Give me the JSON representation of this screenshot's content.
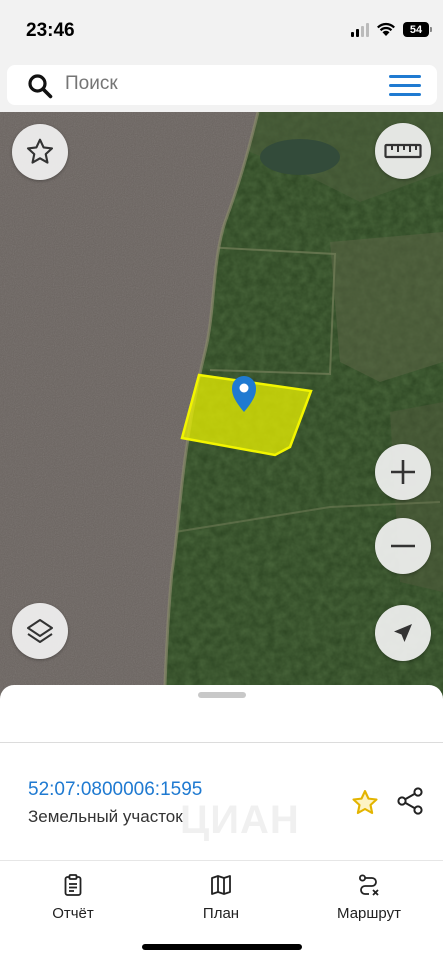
{
  "status_bar": {
    "time": "23:46",
    "battery": "54",
    "icons": [
      "signal-icon",
      "wifi-icon",
      "battery-icon"
    ]
  },
  "search": {
    "placeholder": "Поиск",
    "icon": "search-icon",
    "menu_icon": "hamburger-menu-icon"
  },
  "map": {
    "buttons": [
      "star-icon",
      "ruler-icon",
      "layers-icon",
      "zoom-in-icon",
      "zoom-out-icon",
      "location-arrow-icon"
    ],
    "parcel_color": "#e8f000",
    "marker_color": "#1f7ad1"
  },
  "parcel": {
    "cadastral_number": "52:07:0800006:1595",
    "type": "Земельный участок",
    "favorite_color": "#e3b400"
  },
  "watermark": "ЦИАН",
  "tabs": [
    {
      "label": "Отчёт",
      "icon": "report-clipboard-icon"
    },
    {
      "label": "План",
      "icon": "map-plan-icon"
    },
    {
      "label": "Маршрут",
      "icon": "route-icon"
    }
  ],
  "colors": {
    "accent": "#1f7ad1",
    "water": "#6b6460",
    "forest": "#2f4a22"
  }
}
